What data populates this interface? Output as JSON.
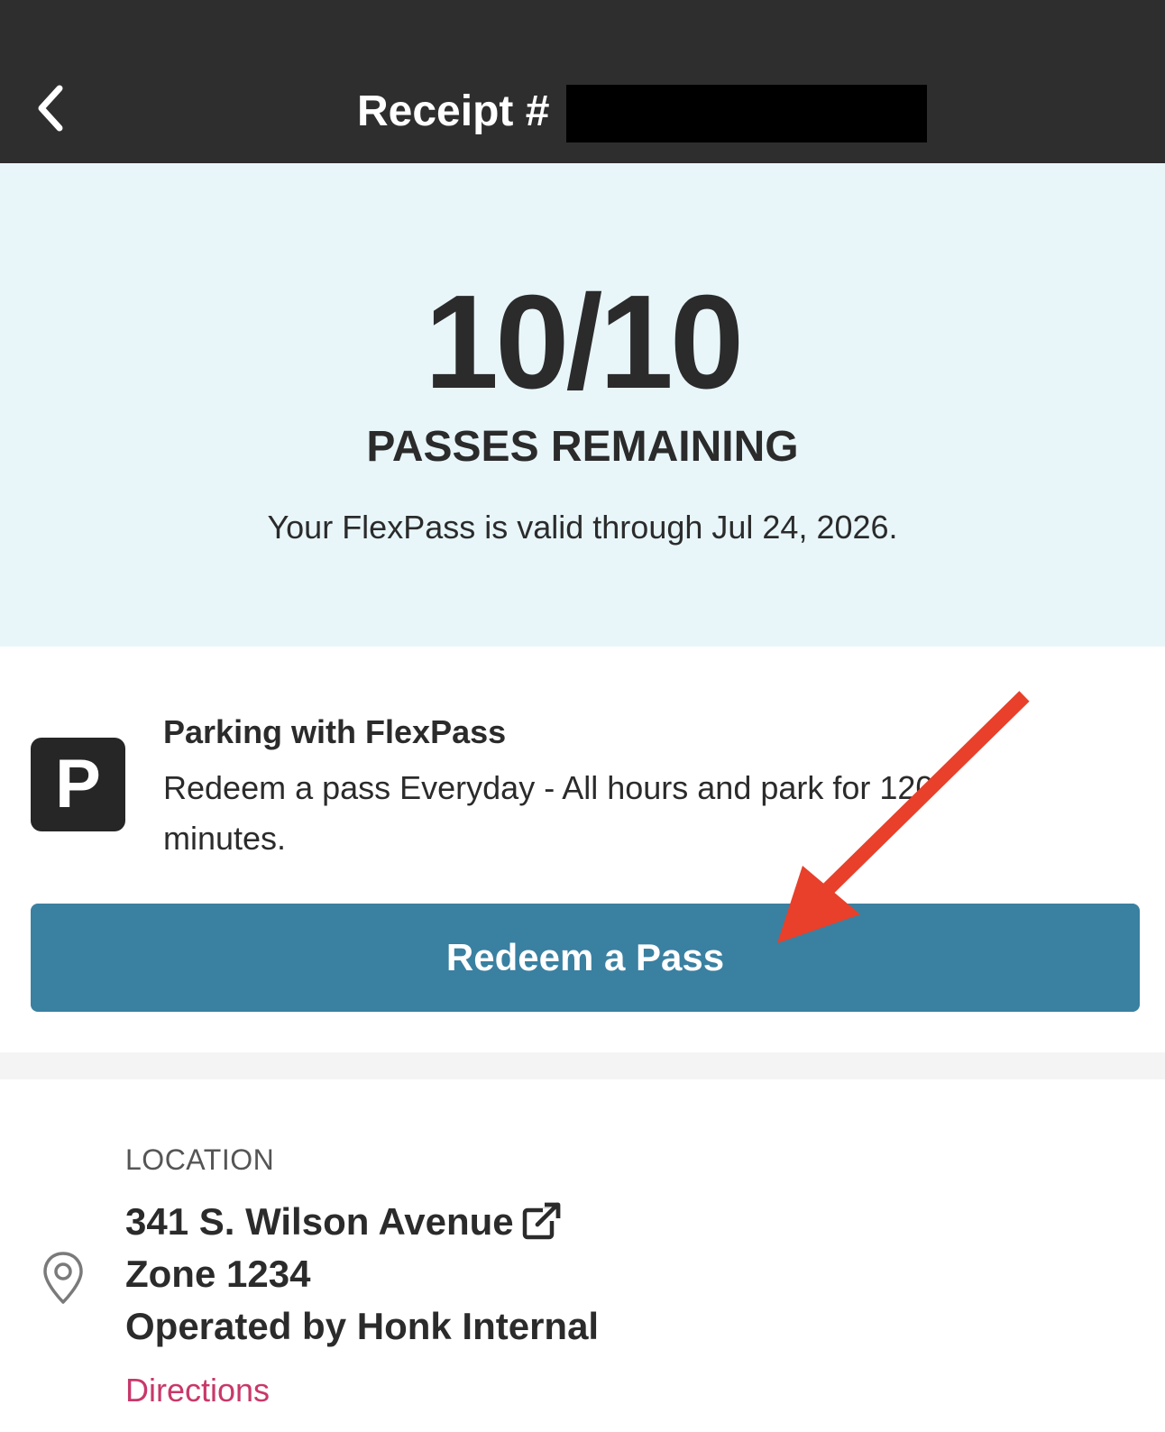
{
  "header": {
    "title": "Receipt #",
    "back_icon": "chevron-left-icon"
  },
  "hero": {
    "pass_count": "10/10",
    "pass_label": "PASSES REMAINING",
    "valid_text": "Your FlexPass is valid through Jul 24, 2026."
  },
  "product": {
    "icon_letter": "P",
    "title": "Parking with FlexPass",
    "description": "Redeem a pass Everyday - All hours and park for 120 minutes.",
    "redeem_button": "Redeem a Pass"
  },
  "location": {
    "label": "LOCATION",
    "address": "341 S. Wilson Avenue",
    "zone": "Zone 1234",
    "operator": "Operated by Honk Internal",
    "directions": "Directions"
  },
  "colors": {
    "header_bg": "#2e2e2e",
    "hero_bg": "#e8f6fa",
    "button_bg": "#3a80a1",
    "link": "#c8386a",
    "annotation_arrow": "#e8402a"
  }
}
